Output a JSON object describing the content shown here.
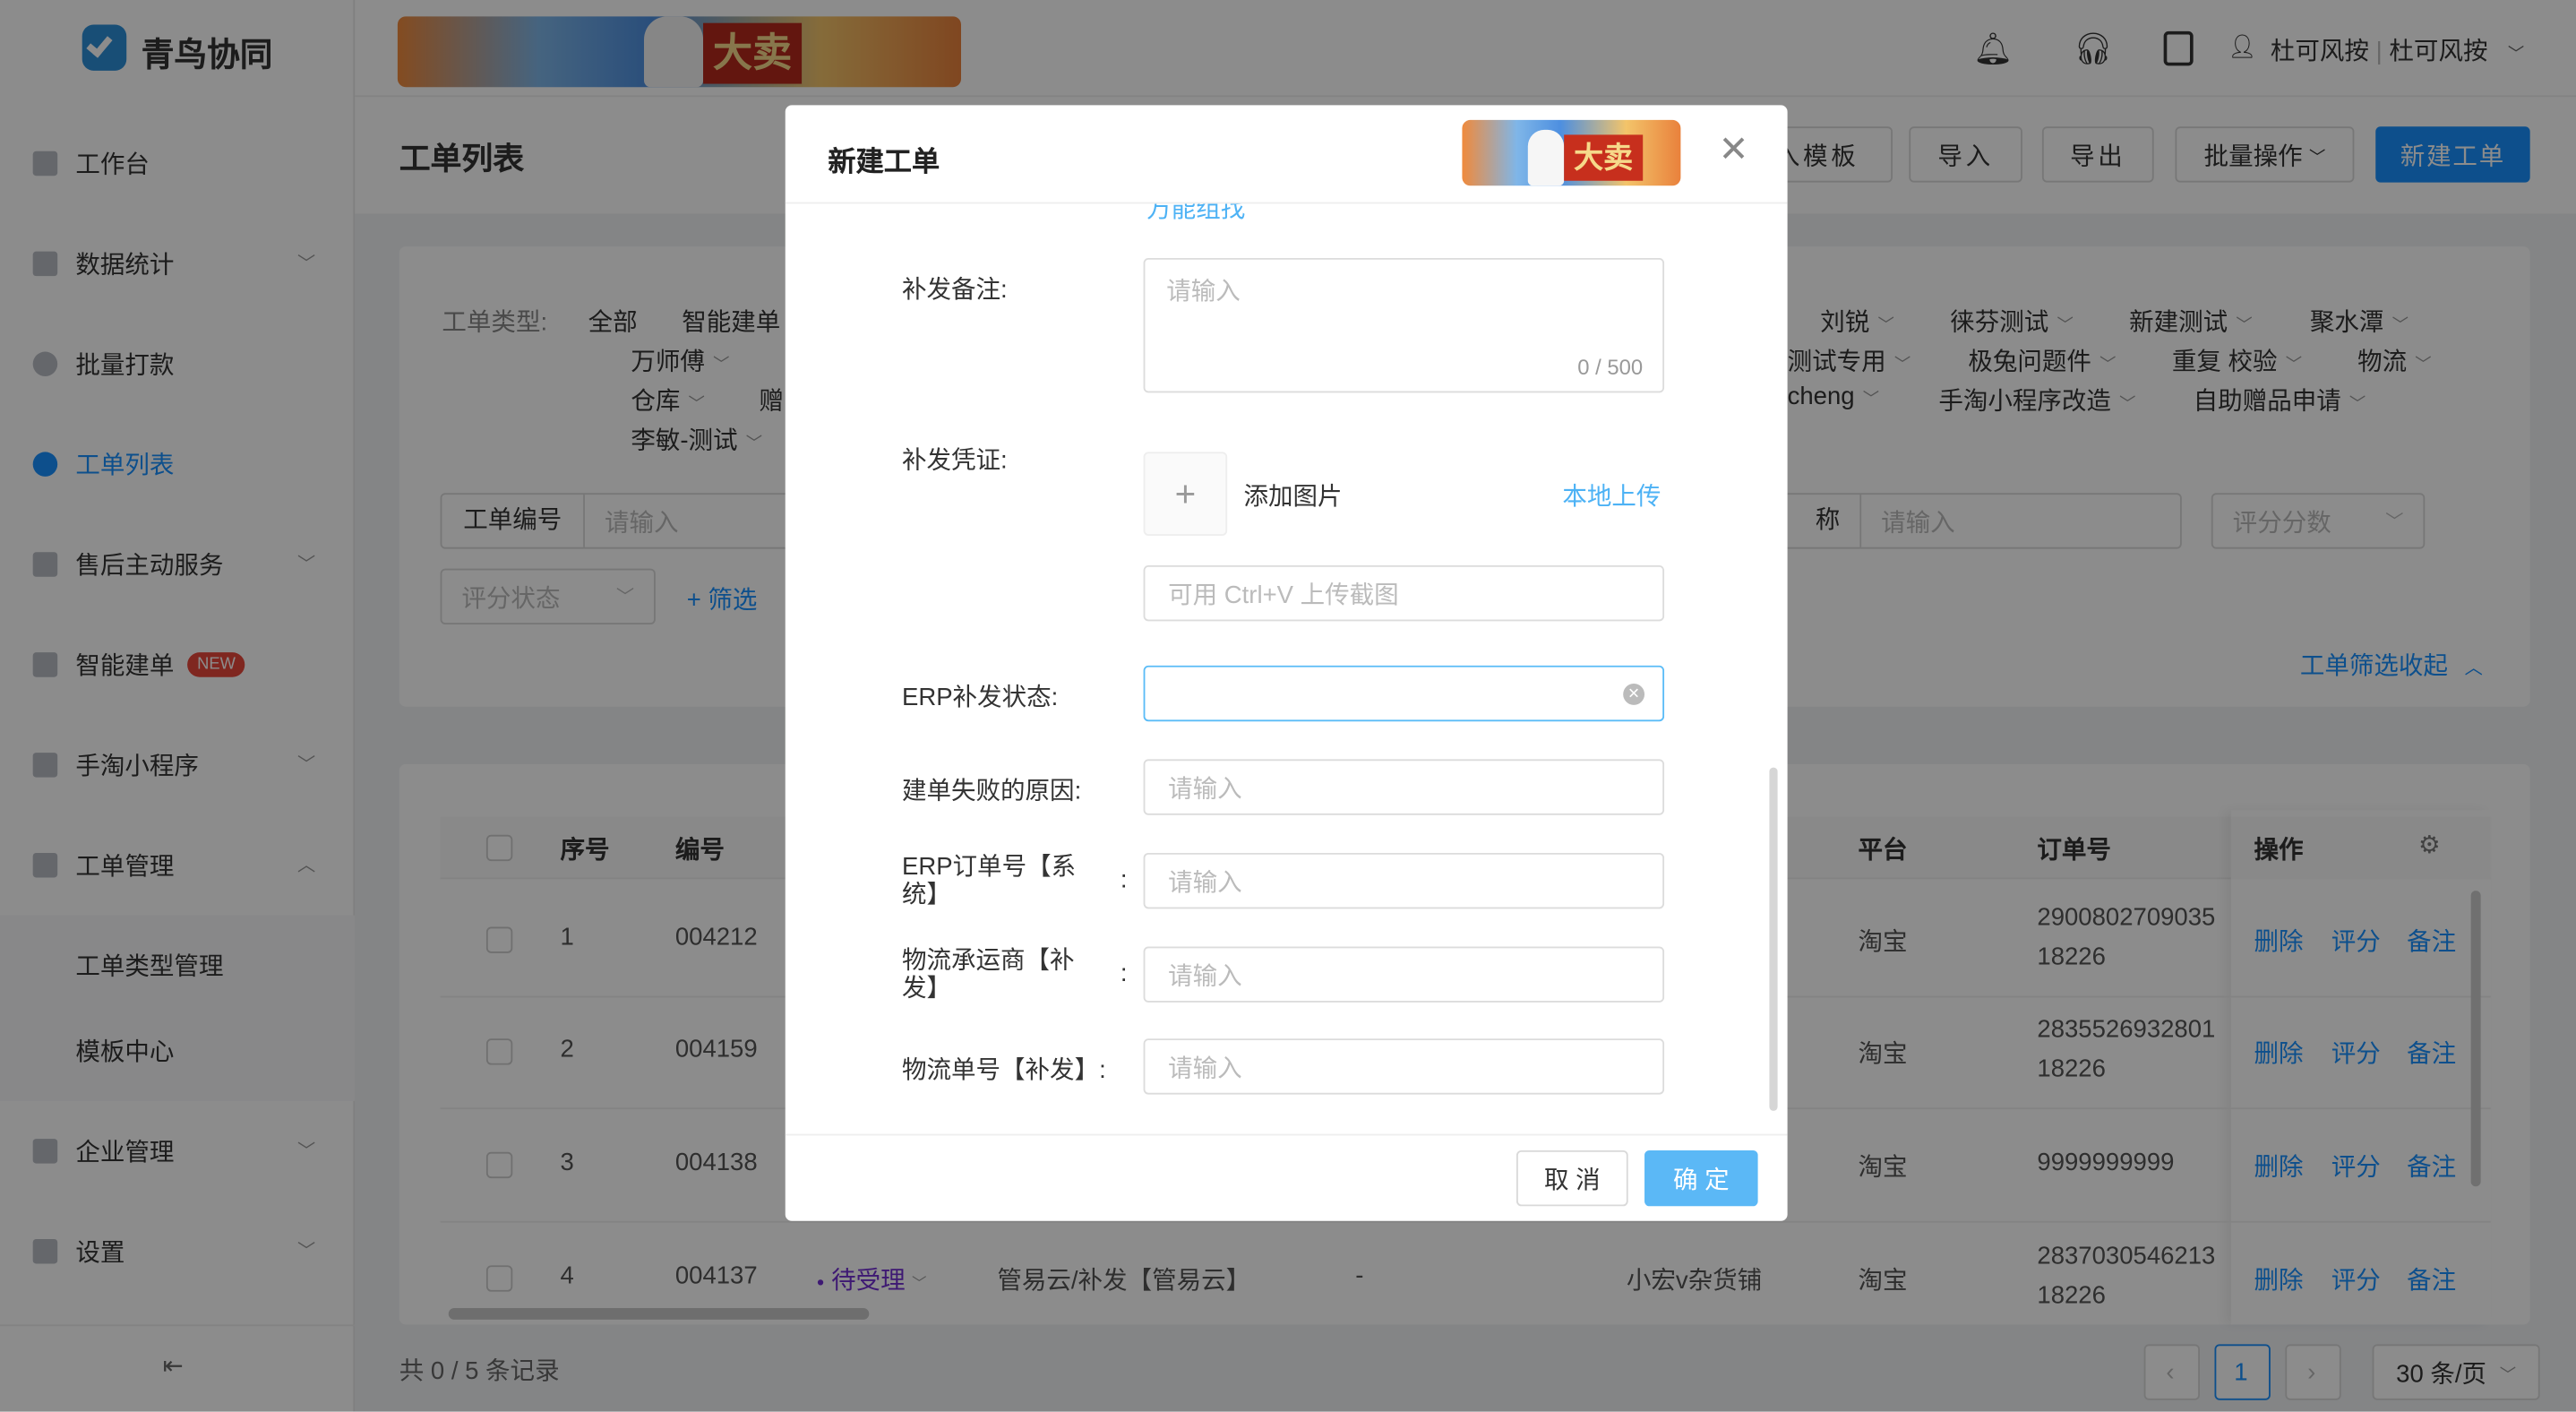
{
  "app": {
    "name": "青鸟协同",
    "banner_text": "大卖"
  },
  "sidebar": {
    "items": [
      {
        "label": "工作台",
        "icon": "monitor-icon"
      },
      {
        "label": "数据统计",
        "icon": "bar-chart-icon",
        "expandable": true
      },
      {
        "label": "批量打款",
        "icon": "coin-icon"
      },
      {
        "label": "工单列表",
        "icon": "search-icon",
        "active": true
      },
      {
        "label": "售后主动服务",
        "icon": "service-icon",
        "expandable": true
      },
      {
        "label": "智能建单",
        "icon": "doc-icon",
        "badge": "NEW"
      },
      {
        "label": "手淘小程序",
        "icon": "bag-icon",
        "expandable": true
      },
      {
        "label": "工单管理",
        "icon": "ticket-icon",
        "expanded": true
      },
      {
        "label": "企业管理",
        "icon": "building-icon",
        "expandable": true
      },
      {
        "label": "设置",
        "icon": "settings-icon",
        "expandable": true
      }
    ],
    "sub_items": [
      "工单类型管理",
      "模板中心"
    ]
  },
  "header": {
    "user": "杜可风按",
    "org": "杜可风按"
  },
  "page": {
    "title": "工单列表",
    "buttons": {
      "template": "入模板",
      "import": "导入",
      "export": "导出",
      "batch": "批量操作",
      "create": "新建工单"
    }
  },
  "filters": {
    "type_label": "工单类型:",
    "tags_row1": [
      "全部",
      "智能建单"
    ],
    "tags_left": [
      "万师傅",
      "仓库",
      "赠",
      "李敏-测试"
    ],
    "tags_right": [
      "刘锐",
      "徕芬测试",
      "新建测试",
      "聚水潭",
      "测试专用",
      "极兔问题件",
      "重复 校验",
      "物流",
      "cheng",
      "手淘小程序改造",
      "自助赠品申请"
    ],
    "order_no_label": "工单编号",
    "placeholder": "请输入",
    "name_label": "称",
    "score_value": "评分分数",
    "score_status": "评分状态",
    "add_filter": "+ 筛选",
    "collapse": "工单筛选收起"
  },
  "table": {
    "headers": {
      "index": "序号",
      "no": "编号",
      "platform": "平台",
      "order": "订单号",
      "ops": "操作"
    },
    "rows": [
      {
        "index": "1",
        "no": "004212",
        "platform": "淘宝",
        "order": [
          "2900802709035",
          "18226"
        ]
      },
      {
        "index": "2",
        "no": "004159",
        "platform": "淘宝",
        "order": [
          "2835526932801",
          "18226"
        ]
      },
      {
        "index": "3",
        "no": "004138",
        "platform": "淘宝",
        "order": [
          "9999999999"
        ]
      },
      {
        "index": "4",
        "no": "004137",
        "status": "待受理",
        "type": "管易云/补发【管易云】",
        "dash": "-",
        "shop": "小宏v杂货铺",
        "platform": "淘宝",
        "order": [
          "2837030546213",
          "18226"
        ]
      }
    ],
    "ops": [
      "删除",
      "评分",
      "备注"
    ],
    "status_color": "#722ed1"
  },
  "footer": {
    "total": "共 0 / 5 条记录",
    "page": "1",
    "page_size": "30 条/页"
  },
  "modal": {
    "title": "新建工单",
    "clipped_link": "万能组找",
    "remark_label": "补发备注:",
    "remark_placeholder": "请输入",
    "remark_count": "0 / 500",
    "proof_label": "补发凭证:",
    "add_image": "添加图片",
    "local_upload": "本地上传",
    "paste_placeholder": "可用 Ctrl+V 上传截图",
    "erp_status_label": "ERP补发状态:",
    "fail_reason_label": "建单失败的原因:",
    "erp_order_label": "ERP订单号【系统】",
    "carrier_label": "物流承运商【补发】",
    "tracking_label": "物流单号【补发】:",
    "colon": ":",
    "placeholder": "请输入",
    "cancel": "取 消",
    "ok": "确 定"
  },
  "colors": {
    "primary": "#1890ff",
    "confirm": "#5bb8f6"
  }
}
